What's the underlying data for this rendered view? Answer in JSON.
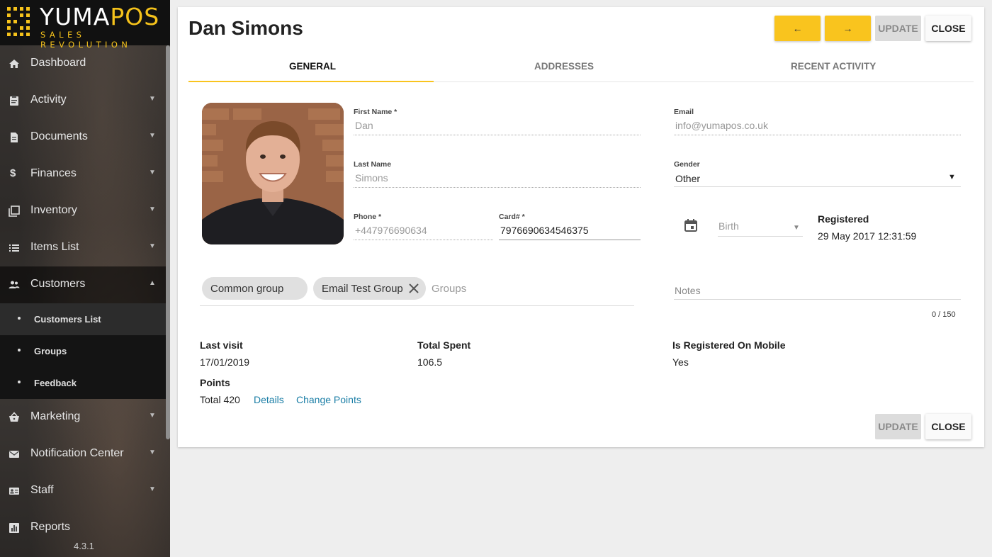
{
  "brand": {
    "name_white": "YUMA",
    "name_yellow": "POS",
    "tagline": "SALES REVOLUTION",
    "version": "4.3.1"
  },
  "sidebar": {
    "items": [
      {
        "label": "Dashboard",
        "icon": "home-icon",
        "has_chevron": false
      },
      {
        "label": "Activity",
        "icon": "clipboard-icon",
        "has_chevron": true
      },
      {
        "label": "Documents",
        "icon": "document-icon",
        "has_chevron": true
      },
      {
        "label": "Finances",
        "icon": "dollar-icon",
        "has_chevron": true
      },
      {
        "label": "Inventory",
        "icon": "inventory-icon",
        "has_chevron": true
      },
      {
        "label": "Items List",
        "icon": "list-icon",
        "has_chevron": true
      },
      {
        "label": "Customers",
        "icon": "people-icon",
        "has_chevron": true,
        "expanded": true
      },
      {
        "label": "Marketing",
        "icon": "basket-icon",
        "has_chevron": true
      },
      {
        "label": "Notification Center",
        "icon": "mail-icon",
        "has_chevron": true
      },
      {
        "label": "Staff",
        "icon": "badge-icon",
        "has_chevron": true
      },
      {
        "label": "Reports",
        "icon": "chart-icon",
        "has_chevron": false
      }
    ],
    "customers_sub": [
      "Customers List",
      "Groups",
      "Feedback"
    ]
  },
  "customer": {
    "name": "Dan Simons",
    "first_name_label": "First Name *",
    "first_name": "Dan",
    "last_name_label": "Last Name",
    "last_name": "Simons",
    "phone_label": "Phone *",
    "phone": "+447976690634",
    "card_label": "Card# *",
    "card": "7976690634546375",
    "email_label": "Email",
    "email": "info@yumapos.co.uk",
    "gender_label": "Gender",
    "gender": "Other",
    "birth_placeholder": "Birth",
    "registered_label": "Registered",
    "registered": "29 May 2017 12:31:59",
    "groups": [
      "Common group",
      "Email Test Group"
    ],
    "groups_placeholder": "Groups",
    "notes_label": "Notes",
    "notes_counter": "0 / 150",
    "last_visit_label": "Last visit",
    "last_visit": "17/01/2019",
    "total_spent_label": "Total Spent",
    "total_spent": "106.5",
    "mobile_label": "Is Registered On Mobile",
    "mobile": "Yes",
    "points_label": "Points",
    "points": "Total 420",
    "details_link": "Details",
    "change_points_link": "Change Points"
  },
  "toolbar": {
    "prev": "←",
    "next": "→",
    "update": "UPDATE",
    "close": "CLOSE"
  },
  "tabs": [
    "GENERAL",
    "ADDRESSES",
    "RECENT ACTIVITY"
  ],
  "colors": {
    "accent": "#f9c41e",
    "link": "#1b7ea6"
  }
}
